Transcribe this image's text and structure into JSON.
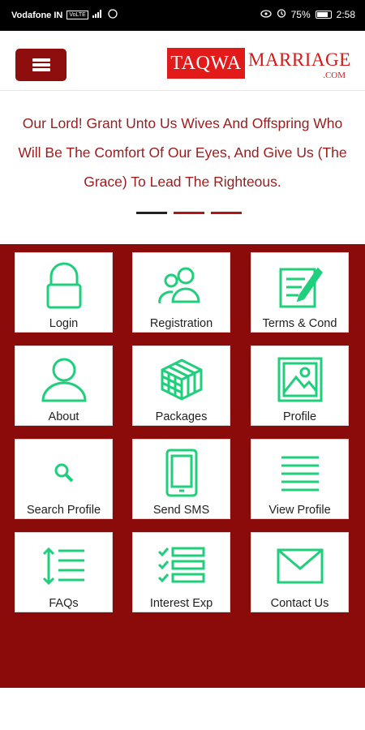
{
  "status_bar": {
    "carrier": "Vodafone IN",
    "volte_badge": "VoLTE",
    "signal": "4G",
    "battery": "75%",
    "time": "2:58"
  },
  "header": {
    "menu_icon": "hamburger-menu-icon",
    "logo_part1": "TAQWA",
    "logo_part2": "MARRIAGE",
    "logo_part3": ".COM",
    "brand_color": "#8e0d0d",
    "accent_color": "#1fcf7c"
  },
  "verse": {
    "text": "Our Lord! Grant Unto Us Wives And Offspring Who Will Be The Comfort Of Our Eyes, And Give Us (The Grace) To Lead The Righteous."
  },
  "carousel": {
    "slides": 3,
    "active_index": 0
  },
  "tiles": [
    {
      "label": "Login",
      "icon": "lock-icon"
    },
    {
      "label": "Registration",
      "icon": "users-icon"
    },
    {
      "label": "Terms & Cond",
      "icon": "edit-document-icon"
    },
    {
      "label": "About",
      "icon": "user-icon"
    },
    {
      "label": "Packages",
      "icon": "cube-icon"
    },
    {
      "label": "Profile",
      "icon": "image-icon"
    },
    {
      "label": "Search Profile",
      "icon": "search-icon"
    },
    {
      "label": "Send SMS",
      "icon": "mobile-icon"
    },
    {
      "label": "View Profile",
      "icon": "list-lines-icon"
    },
    {
      "label": "FAQs",
      "icon": "vertical-arrows-list-icon"
    },
    {
      "label": "Interest Exp",
      "icon": "checklist-icon"
    },
    {
      "label": "Contact Us",
      "icon": "envelope-icon"
    }
  ]
}
